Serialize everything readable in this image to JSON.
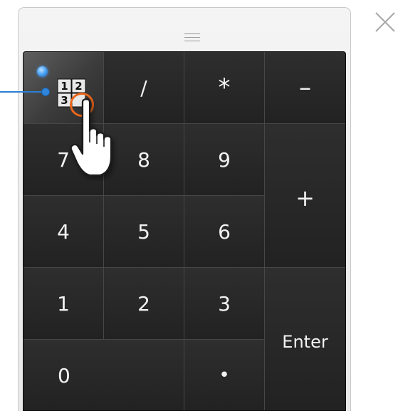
{
  "keypad": {
    "row1": {
      "numlock_icon": "numlock-grid-icon",
      "numlock_icon_digits": [
        "1",
        "2",
        "3"
      ],
      "divide": "/",
      "multiply": "*",
      "minus": "–"
    },
    "row2": {
      "seven": "7",
      "eight": "8",
      "nine": "9",
      "plus": "+"
    },
    "row3": {
      "four": "4",
      "five": "5",
      "six": "6"
    },
    "row4": {
      "one": "1",
      "two": "2",
      "three": "3",
      "enter": "Enter"
    },
    "row5": {
      "zero": "0",
      "decimal": "•"
    }
  },
  "window": {
    "grip_icon": "drag-grip-icon",
    "close_icon": "close-icon"
  },
  "annotations": {
    "indicator_color": "#4ea6f5",
    "callout_color": "#2b7fd4",
    "tap_ring_color": "#e8661a",
    "cursor_icon": "hand-pointer-icon"
  }
}
